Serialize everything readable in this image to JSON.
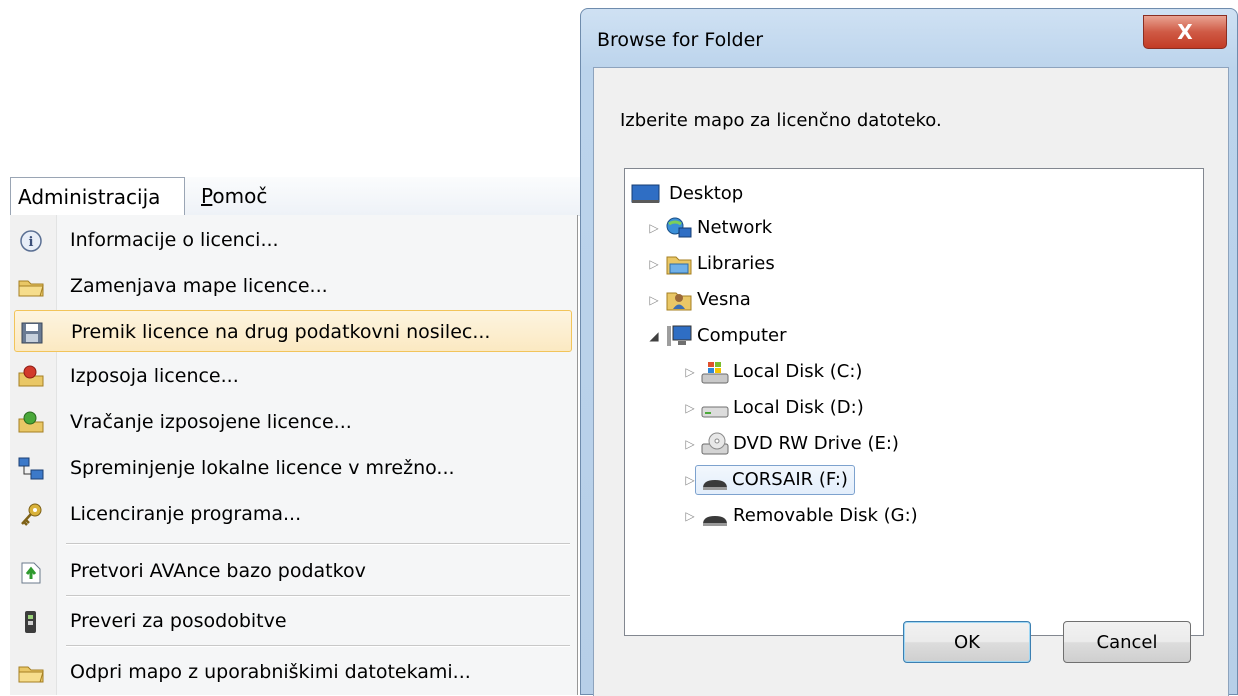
{
  "menubar": {
    "active_menu": "Administracija",
    "other_menu_prefix": "",
    "other_menu_underlined": "P",
    "other_menu_rest": "omoč"
  },
  "menu": {
    "items": [
      {
        "label": "Informacije o licenci...",
        "icon": "info-icon"
      },
      {
        "label": "Zamenjava mape licence...",
        "icon": "folder-icon"
      },
      {
        "label": "Premik licence na drug podatkovni nosilec...",
        "icon": "floppy-disk-icon",
        "highlighted": true
      },
      {
        "label": "Izposoja licence...",
        "icon": "folder-red-icon"
      },
      {
        "label": "Vračanje izposojene licence...",
        "icon": "folder-green-icon"
      },
      {
        "label": "Spreminjenje lokalne licence v mrežno...",
        "icon": "network-computers-icon"
      },
      {
        "label": "Licenciranje programa...",
        "icon": "key-icon"
      },
      {
        "label": "Pretvori AVAnce bazo podatkov",
        "icon": "database-convert-icon"
      },
      {
        "label": "Preveri za posodobitve",
        "icon": "update-icon"
      },
      {
        "label": "Odpri mapo z uporabniškimi datotekami...",
        "icon": "folder-icon"
      }
    ]
  },
  "dialog": {
    "title": "Browse for Folder",
    "close_label": "X",
    "prompt": "Izberite mapo za licenčno datoteko.",
    "tree": [
      {
        "label": "Desktop",
        "icon": "desktop-icon",
        "level": 0,
        "expander": ""
      },
      {
        "label": "Network",
        "icon": "network-icon",
        "level": 1,
        "expander": "▷"
      },
      {
        "label": "Libraries",
        "icon": "libraries-icon",
        "level": 1,
        "expander": "▷"
      },
      {
        "label": "Vesna",
        "icon": "user-folder-icon",
        "level": 1,
        "expander": "▷"
      },
      {
        "label": "Computer",
        "icon": "computer-icon",
        "level": 1,
        "expander": "◢"
      },
      {
        "label": "Local Disk (C:)",
        "icon": "windows-drive-icon",
        "level": 2,
        "expander": "▷"
      },
      {
        "label": "Local Disk (D:)",
        "icon": "hard-drive-icon",
        "level": 2,
        "expander": "▷"
      },
      {
        "label": "DVD RW Drive (E:)",
        "icon": "dvd-drive-icon",
        "level": 2,
        "expander": "▷"
      },
      {
        "label": "CORSAIR (F:)",
        "icon": "usb-drive-icon",
        "level": 2,
        "expander": "▷",
        "selected": true
      },
      {
        "label": "Removable Disk (G:)",
        "icon": "usb-drive-icon",
        "level": 2,
        "expander": "▷"
      }
    ],
    "ok_label": "OK",
    "cancel_label": "Cancel"
  },
  "colors": {
    "menu_highlight": "#fbe9c2",
    "menu_highlight_border": "#f2c45a",
    "dialog_frame": "#bcd4ec",
    "close_button": "#c23b25",
    "tree_selection": "#e3eefb"
  }
}
